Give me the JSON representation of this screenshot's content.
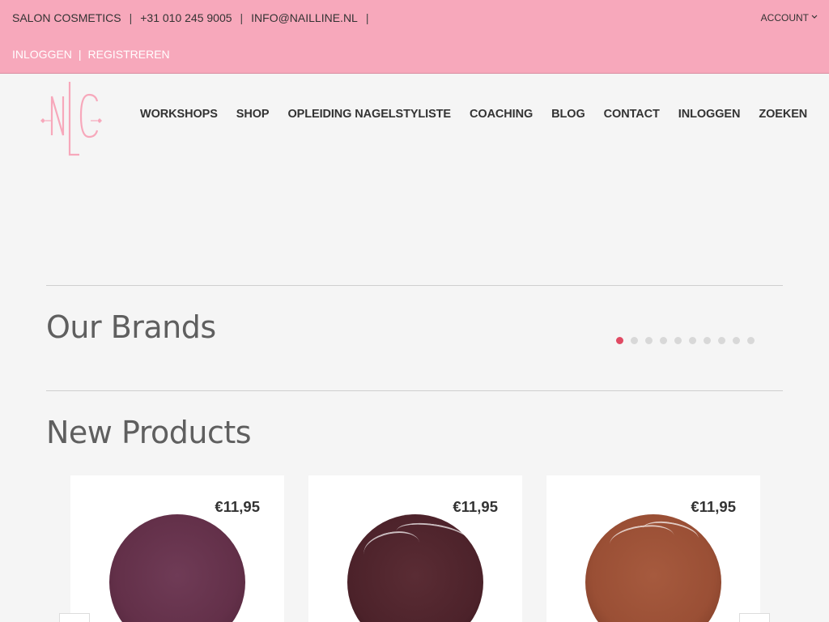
{
  "topbar": {
    "company": "SALON COSMETICS",
    "phone": "+31 010 245 9005",
    "email": "INFO@NAILLINE.NL",
    "account_label": "ACCOUNT",
    "login_label": "INLOGGEN",
    "register_label": "REGISTREREN",
    "background_color": "#f7a8bb"
  },
  "logo": {
    "text": "NLC",
    "color": "#f7a8bb"
  },
  "nav": {
    "items": [
      {
        "label": "WORKSHOPS"
      },
      {
        "label": "SHOP"
      },
      {
        "label": "OPLEIDING NAGELSTYLISTE"
      },
      {
        "label": "COACHING"
      },
      {
        "label": "BLOG"
      },
      {
        "label": "CONTACT"
      },
      {
        "label": "INLOGGEN"
      },
      {
        "label": "ZOEKEN"
      }
    ]
  },
  "brands": {
    "title": "Our Brands",
    "carousel_pages": 10,
    "active_page": 1,
    "active_color": "#e04a63"
  },
  "new_products": {
    "title": "New Products",
    "items": [
      {
        "price": "€11,95",
        "swatch_color": "#633049"
      },
      {
        "price": "€11,95",
        "swatch_color": "#4c222a"
      },
      {
        "price": "€11,95",
        "swatch_color": "#9a4f35"
      }
    ]
  },
  "icons": {
    "account_chevron": "chevron-down-icon",
    "prev_arrow": "chevron-left-icon",
    "next_arrow": "chevron-right-icon"
  }
}
